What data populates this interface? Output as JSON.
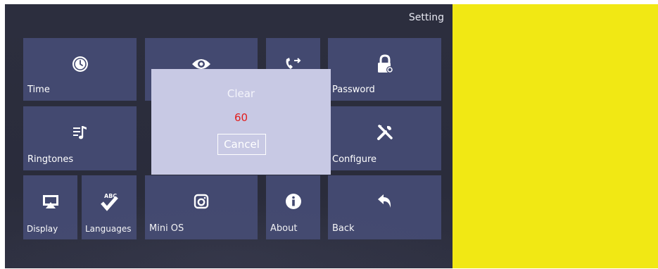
{
  "header": {
    "title": "Setting"
  },
  "tiles": {
    "time": {
      "label": "Time",
      "icon": "clock-icon"
    },
    "monitor": {
      "label": "",
      "icon": "eye-icon"
    },
    "call": {
      "label": "",
      "icon": "call-forward-icon"
    },
    "password": {
      "label": "Password",
      "icon": "lock-icon"
    },
    "ringtones": {
      "label": "Ringtones",
      "icon": "music-list-icon"
    },
    "configure": {
      "label": "Configure",
      "icon": "tools-icon"
    },
    "display": {
      "label": "Display",
      "icon": "display-icon"
    },
    "languages": {
      "label": "Languages",
      "icon": "abc-check-icon"
    },
    "mini_os": {
      "label": "Mini OS",
      "icon": "instagram-icon"
    },
    "about": {
      "label": "About",
      "icon": "info-icon"
    },
    "back": {
      "label": "Back",
      "icon": "back-arrow-icon"
    }
  },
  "dialog": {
    "title": "Clear",
    "countdown": "60",
    "cancel_label": "Cancel"
  },
  "colors": {
    "background": "#2c2e3e",
    "tile": "#434970",
    "dialog": "#c8c9e4",
    "countdown": "#e21c1c",
    "side_panel": "#f1e814"
  }
}
